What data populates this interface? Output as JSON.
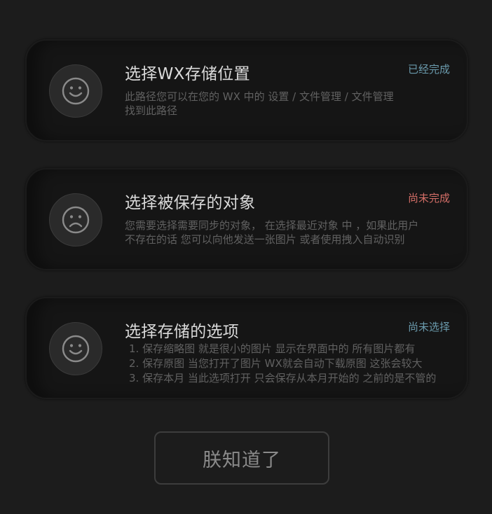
{
  "cards": [
    {
      "icon": "smile-face-icon",
      "title": "选择WX存储位置",
      "status": "已经完成",
      "status_color": "#6a9aac",
      "desc_lines": [
        "此路径您可以在您的 WX 中的  设置  /  文件管理  / 文件管理",
        "找到此路径"
      ]
    },
    {
      "icon": "sad-face-icon",
      "title": "选择被保存的对象",
      "status": "尚未完成",
      "status_color": "#d46e67",
      "desc_lines": [
        "您需要选择需要同步的对象，  在选择最近对象 中     ，如果此用户",
        "不存在的话 您可以向他发送一张图片 或者使用拽入自动识别"
      ]
    },
    {
      "icon": "smile-face-icon",
      "title": "选择存储的选项",
      "status": "尚未选择",
      "status_color": "#6a9aac",
      "desc_lines": [
        "1. 保存缩略图   就是很小的图片 显示在界面中的 所有图片都有",
        "2. 保存原图  当您打开了图片 WX就会自动下载原图 这张会较大",
        "3. 保存本月 当此选项打开 只会保存从本月开始的  之前的是不管的"
      ]
    }
  ],
  "ok_button": {
    "label": "朕知道了"
  }
}
